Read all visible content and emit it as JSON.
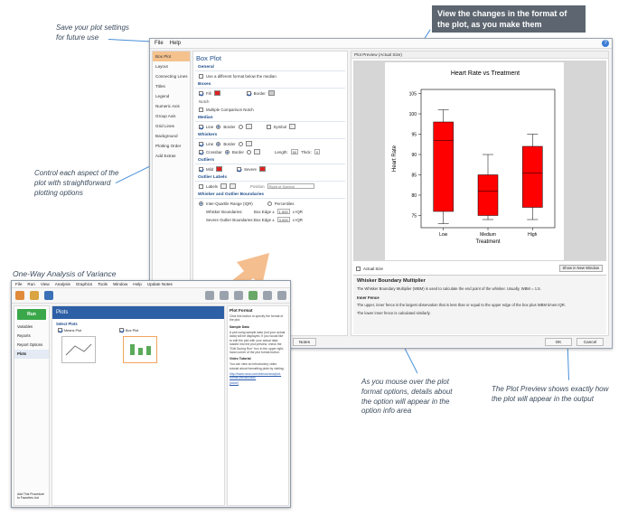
{
  "callouts": {
    "save": "Save your plot settings\nfor future use",
    "control": "Control each aspect of the\nplot with straightforward\nplotting options",
    "oneway": "One-Way Analysis of Variance",
    "preview_top": "View the changes in the format of\nthe plot, as you make them",
    "mouse": "As you mouse over the plot\nformat options, details about\nthe option will appear in the\noption info area",
    "preview_bottom": "The Plot Preview shows exactly how\nthe plot will appear in the output"
  },
  "menu": {
    "file": "File",
    "help": "Help",
    "help_icon": "?"
  },
  "nav": [
    "Box Plot",
    "Layout",
    "Connecting Lines",
    "Titles",
    "Legend",
    "Numeric Axis",
    "Group Axis",
    "Grid Lines",
    "Background",
    "Plotting Order",
    "Add Extras"
  ],
  "options": {
    "title": "Box Plot",
    "general": "General",
    "different_format": "Use a different format below the median",
    "boxes": "Boxes",
    "fill": "Fill",
    "border": "Border",
    "notch": "Notch",
    "multiple_notch": "Multiple Comparison Notch",
    "median": "Median",
    "line": "Line",
    "symbol": "Symbol",
    "whiskers": "Whiskers",
    "crossbar": "Crossbar",
    "length": "Length:",
    "length_val": "50",
    "thick": "Thick:",
    "thick_val": "0",
    "outliers": "Outliers",
    "mild": "Mild",
    "severe": "Severe",
    "outlier_labels": "Outlier Labels",
    "labels": "Labels",
    "position": "Position",
    "position_val": "Right of Symbol",
    "wo_boundaries": "Whisker and Outlier Boundaries",
    "iqr": "Inter-Quartile Range (IQR)",
    "percentiles": "Percentiles",
    "whisker_boundaries": "Whisker Boundaries:",
    "severe_boundaries": "Severe Outlier Boundaries:",
    "box_edge": "Box Edge ±",
    "whisker_mult": "1.500",
    "severe_mult": "3.000",
    "x_iqr": "x IQR",
    "notes_btn": "Notes"
  },
  "preview": {
    "header": "Plot Preview (Actual Size)",
    "actual_size": "Actual Size",
    "show_window": "Show in New Window",
    "info_title": "Whisker Boundary Multiplier",
    "info_text": "The Whisker Boundary Multiplier (WBM) is used to calculate the end point of the whisker. Usually, WBM = 1.5.",
    "info_sub": "Inner Fence",
    "info_text2": "The upper, inner fence is the largest observation that is less than or equal to the upper edge of the box plus WBM times IQR.",
    "info_text3": "The lower inner fence is calculated similarly.",
    "ok": "OK",
    "cancel": "Cancel"
  },
  "chart_data": {
    "type": "box",
    "title": "Heart Rate vs Treatment",
    "xlabel": "Treatment",
    "ylabel": "Heart Rate",
    "categories": [
      "Low",
      "Medium",
      "High"
    ],
    "yticks": [
      75,
      80,
      85,
      90,
      95,
      100,
      105
    ],
    "ylim": [
      72,
      106
    ],
    "boxes": [
      {
        "category": "Low",
        "whisker_low": 73,
        "q1": 76,
        "median": 93.5,
        "q3": 98,
        "whisker_high": 101
      },
      {
        "category": "Medium",
        "whisker_low": 74,
        "q1": 75,
        "median": 81,
        "q3": 85,
        "whisker_high": 90
      },
      {
        "category": "High",
        "whisker_low": 74,
        "q1": 77,
        "median": 85.5,
        "q3": 92,
        "whisker_high": 95
      }
    ],
    "box_color": "#ff0000"
  },
  "ncss": {
    "menus": [
      "File",
      "Run",
      "View",
      "Analysis",
      "Graphics",
      "Tools",
      "Window",
      "Help",
      "Update Notes"
    ],
    "run": "Run",
    "left_items": [
      "Variables",
      "Reports",
      "Report Options",
      "Plots"
    ],
    "banner": "Plots",
    "select_plots": "Select Plots",
    "means_plot": "Means Plot",
    "box_plot": "Box Plot",
    "pf_title": "Plot Format",
    "pf_text": "Click this button to specify the format of the plot.",
    "pf_sample": "Sample Data",
    "pf_sample_text": "A plot using sample data (not your actual data) will be displayed. If you would like to edit the plot with your actual data loaded into the plot preview, check the \"Edit During Run\" box in the upper right-hand corner of the plot format button.",
    "pf_video": "Video Tutorial",
    "pf_video_text": "You can view an introductory video tutorial about formatting plots by visiting:",
    "pf_link": "http://www.ncss.com/videos/ncss/plot-format-introduction/",
    "pf_close": "[close]",
    "left_bottom": "Add This Procedure to Favorites List"
  }
}
